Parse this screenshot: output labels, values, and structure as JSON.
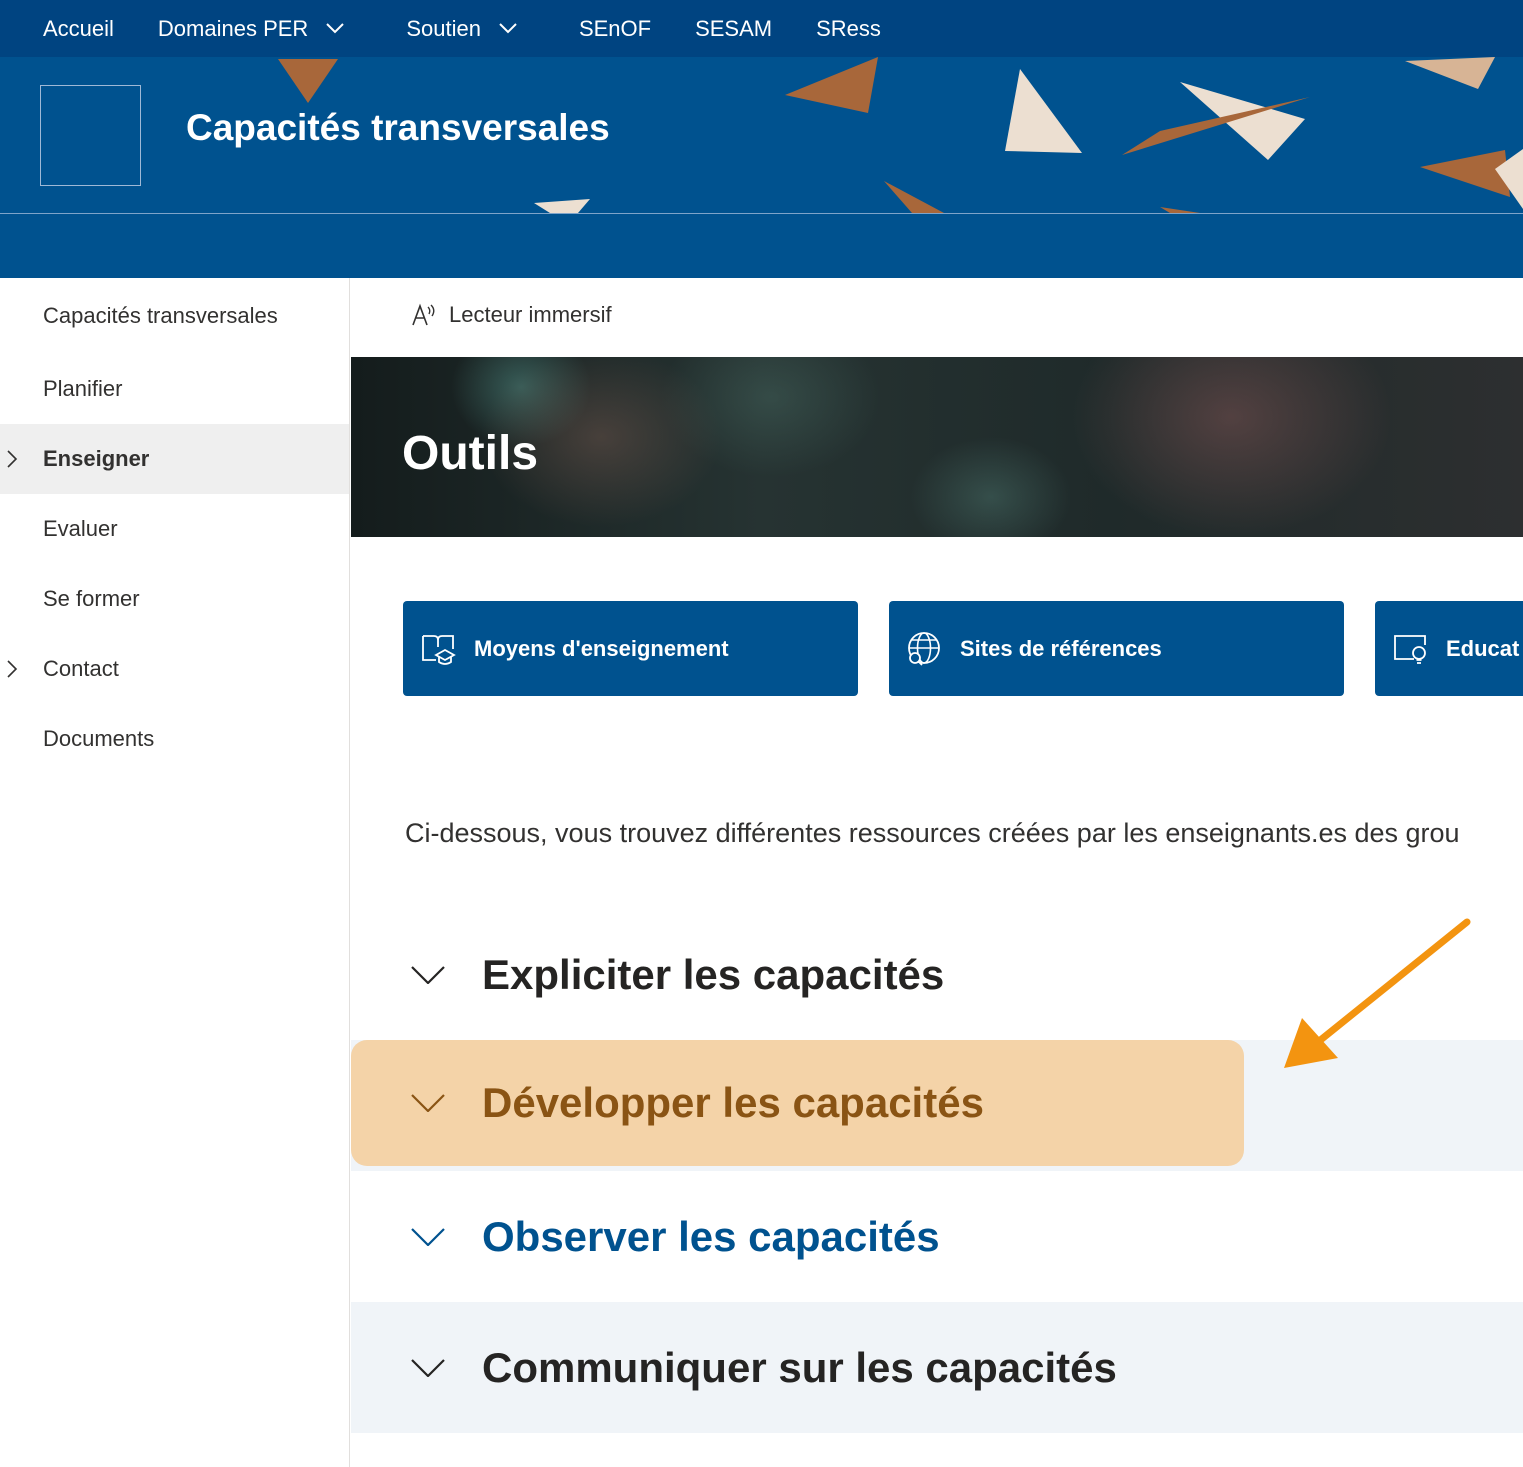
{
  "topnav": {
    "items": [
      {
        "label": "Accueil",
        "dropdown": false
      },
      {
        "label": "Domaines PER",
        "dropdown": true
      },
      {
        "label": "Soutien",
        "dropdown": true
      },
      {
        "label": "SEnOF",
        "dropdown": false
      },
      {
        "label": "SESAM",
        "dropdown": false
      },
      {
        "label": "SRess",
        "dropdown": false
      }
    ]
  },
  "site": {
    "title": "Capacités transversales"
  },
  "sidebar": {
    "items": [
      {
        "label": "Capacités transversales",
        "active": false,
        "expandable": false
      },
      {
        "label": "Planifier",
        "active": false,
        "expandable": false
      },
      {
        "label": "Enseigner",
        "active": true,
        "expandable": true
      },
      {
        "label": "Evaluer",
        "active": false,
        "expandable": false
      },
      {
        "label": "Se former",
        "active": false,
        "expandable": false
      },
      {
        "label": "Contact",
        "active": false,
        "expandable": true
      },
      {
        "label": "Documents",
        "active": false,
        "expandable": false
      }
    ]
  },
  "commandbar": {
    "immersive_reader": "Lecteur immersif"
  },
  "hero": {
    "title": "Outils"
  },
  "quick_links": [
    {
      "label": "Moyens d'enseignement",
      "icon": "book-graduation-icon"
    },
    {
      "label": "Sites de références",
      "icon": "globe-search-icon"
    },
    {
      "label": "Educat",
      "icon": "screen-lightbulb-icon"
    }
  ],
  "intro": {
    "text": "Ci-dessous, vous trouvez différentes ressources créées par les enseignants.es des grou"
  },
  "accordion": {
    "sections": [
      {
        "title": "Expliciter les capacités"
      },
      {
        "title": "Développer les capacités"
      },
      {
        "title": "Observer les capacités"
      },
      {
        "title": "Communiquer sur les capacités"
      }
    ]
  },
  "colors": {
    "nav_bg": "#004481",
    "brand": "#00528f",
    "highlight": "#f4d3a8",
    "annotation_arrow": "#f39410"
  }
}
